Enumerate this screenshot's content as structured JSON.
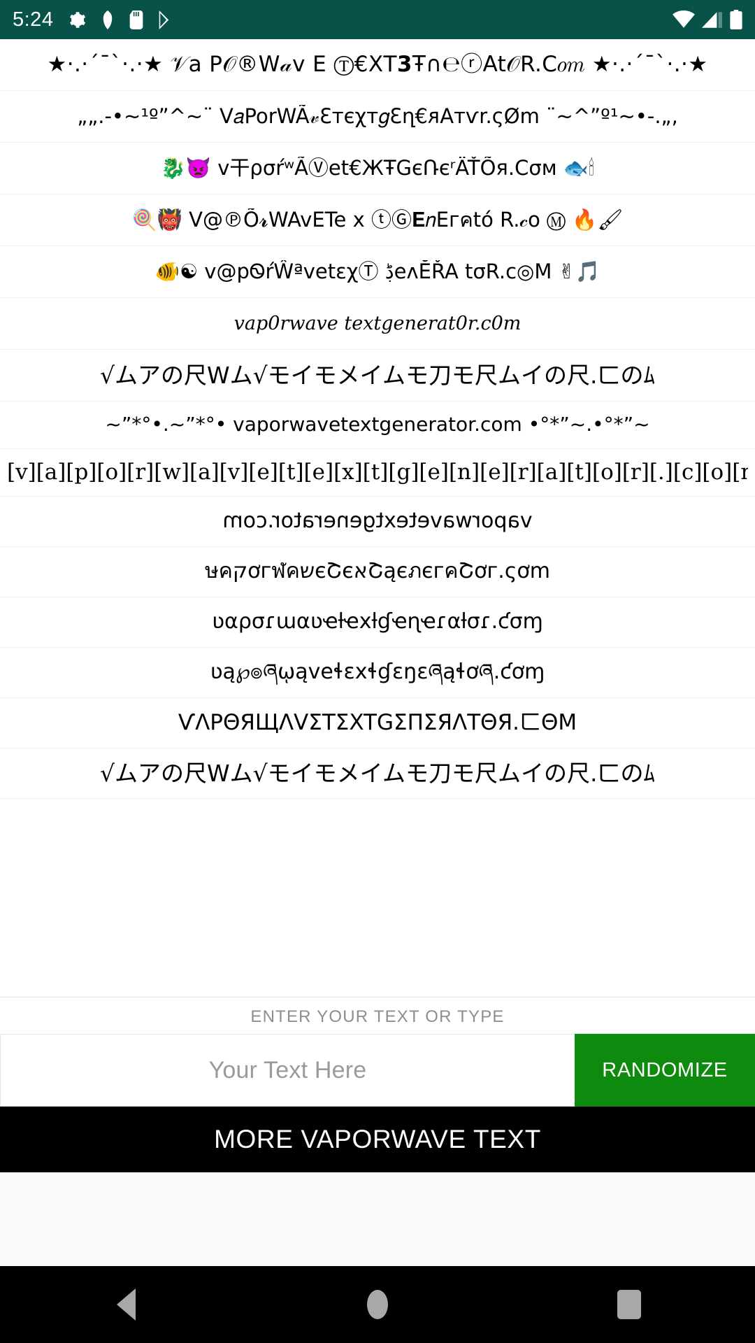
{
  "status_bar": {
    "time": "5:24",
    "left_icons": [
      "gear-icon",
      "shield-icon",
      "sd-card-icon",
      "play-store-icon"
    ],
    "right_icons": [
      "wifi-icon",
      "signal-icon",
      "battery-icon"
    ],
    "background_color": "#09524a"
  },
  "list": {
    "items": [
      {
        "id": "style-1",
        "text": "★·.·´¯`·.·★ 𝒱a P𝒪®W𝒶v E Ⓣ€ΧΤ𝟯Ŧ∩℮ⓡAt𝒪R.C𝑜𝑚 ★·.·´¯`·.·★"
      },
      {
        "id": "style-2",
        "text": "„„.-•~¹º”^~¨ V𝑎PorWÃ𝓋Ԑтєχт𝑔Ɛղ€ᴙAтѵr.ςØm ¨~^”º¹~•-.„,"
      },
      {
        "id": "style-3",
        "text": "🐉👿 v干ρσŕʷÃⓋet€ЖŦGєՌєʳÄŤÕя.Cσм 🐟🕯"
      },
      {
        "id": "style-4",
        "text": "🍭👹 V@℗Õ𝓻WAvΕTe x ⓣⒼ𝐄𝑛Εгคtó R.𝒸o Ⓜ 🔥🖌"
      },
      {
        "id": "style-5",
        "text": "🐠☯ v@pᏫŕŴªvetεχⓉ ڋeᴧĔŘA tσR.c◎M ✌🎵"
      },
      {
        "id": "style-6",
        "text": "vap0rwave textgenerat0r.c0m"
      },
      {
        "id": "style-7",
        "text": "√ムアの尺Wム√モイモメイムモ刀モ尺ムイの尺.ㄈのﾑ"
      },
      {
        "id": "style-8",
        "text": "~”*°•.~”*°• vaporwavetextgenerator.com •°*”~.•°*”~"
      },
      {
        "id": "style-9",
        "text": "[v][a][p][o][r][w][a][v][e][t][e][x][t][g][e][n][e][r][a][t][o][r][.][c][o][m]"
      },
      {
        "id": "style-10",
        "text": "vaporwavetextgenerator.com",
        "flipped": true
      },
      {
        "id": "style-11",
        "text": "ษคקơгฬคשєՇєאՇąєภєгคՇơг.ςơm"
      },
      {
        "id": "style-12",
        "text": "ʋαρσɾɯαʋҽƚҽxƚɠҽɳҽɾαƚσɾ.ƈσɱ"
      },
      {
        "id": "style-13",
        "text": "ʋą℘๏ཞῳąveɬɛxɬɠɛŋɛཞąɬơཞ.ƈơɱ"
      },
      {
        "id": "style-14",
        "text": "ѴΛPΘЯЩΛVΣTΣXTGΣΠΣЯΛTΘЯ.ㄈΘM"
      },
      {
        "id": "style-15",
        "text": "√ムアの尺Wム√モイモメイムモ刀モ尺ムイの尺.ㄈのﾑ"
      }
    ]
  },
  "input_section": {
    "label": "ENTER YOUR TEXT OR TYPE",
    "placeholder": "Your Text Here",
    "value": "",
    "randomize_label": "RANDOMIZE",
    "randomize_color": "#0e8a0e"
  },
  "more_button": {
    "label": "MORE VAPORWAVE TEXT",
    "background_color": "#000000"
  },
  "nav_bar": {
    "back": "back-triangle-icon",
    "home": "home-circle-icon",
    "recents": "recents-square-icon",
    "background_color": "#000000"
  }
}
